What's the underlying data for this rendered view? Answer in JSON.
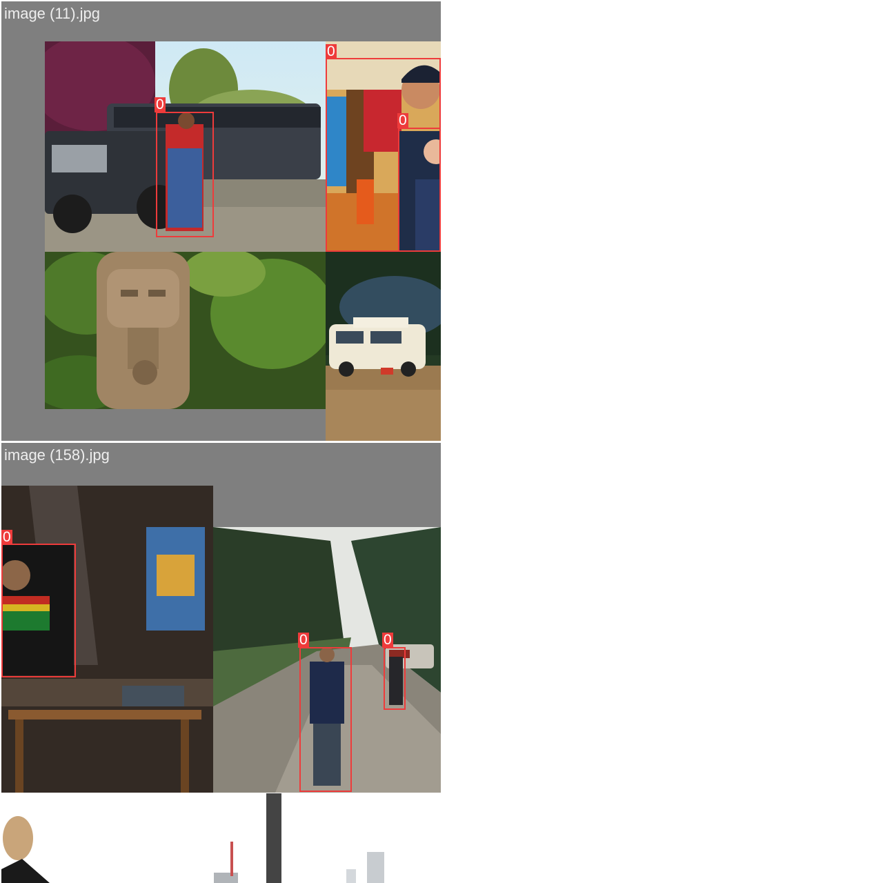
{
  "tiles": [
    {
      "title": "image (11).jpg"
    },
    {
      "title": "image (158).jpg"
    }
  ],
  "detections": {
    "class_label": "0",
    "box_color": "#ee3b3b"
  },
  "colors": {
    "background": "#ffffff",
    "tile_gray": "#7f7f7f",
    "title_text": "#eeeeee"
  }
}
